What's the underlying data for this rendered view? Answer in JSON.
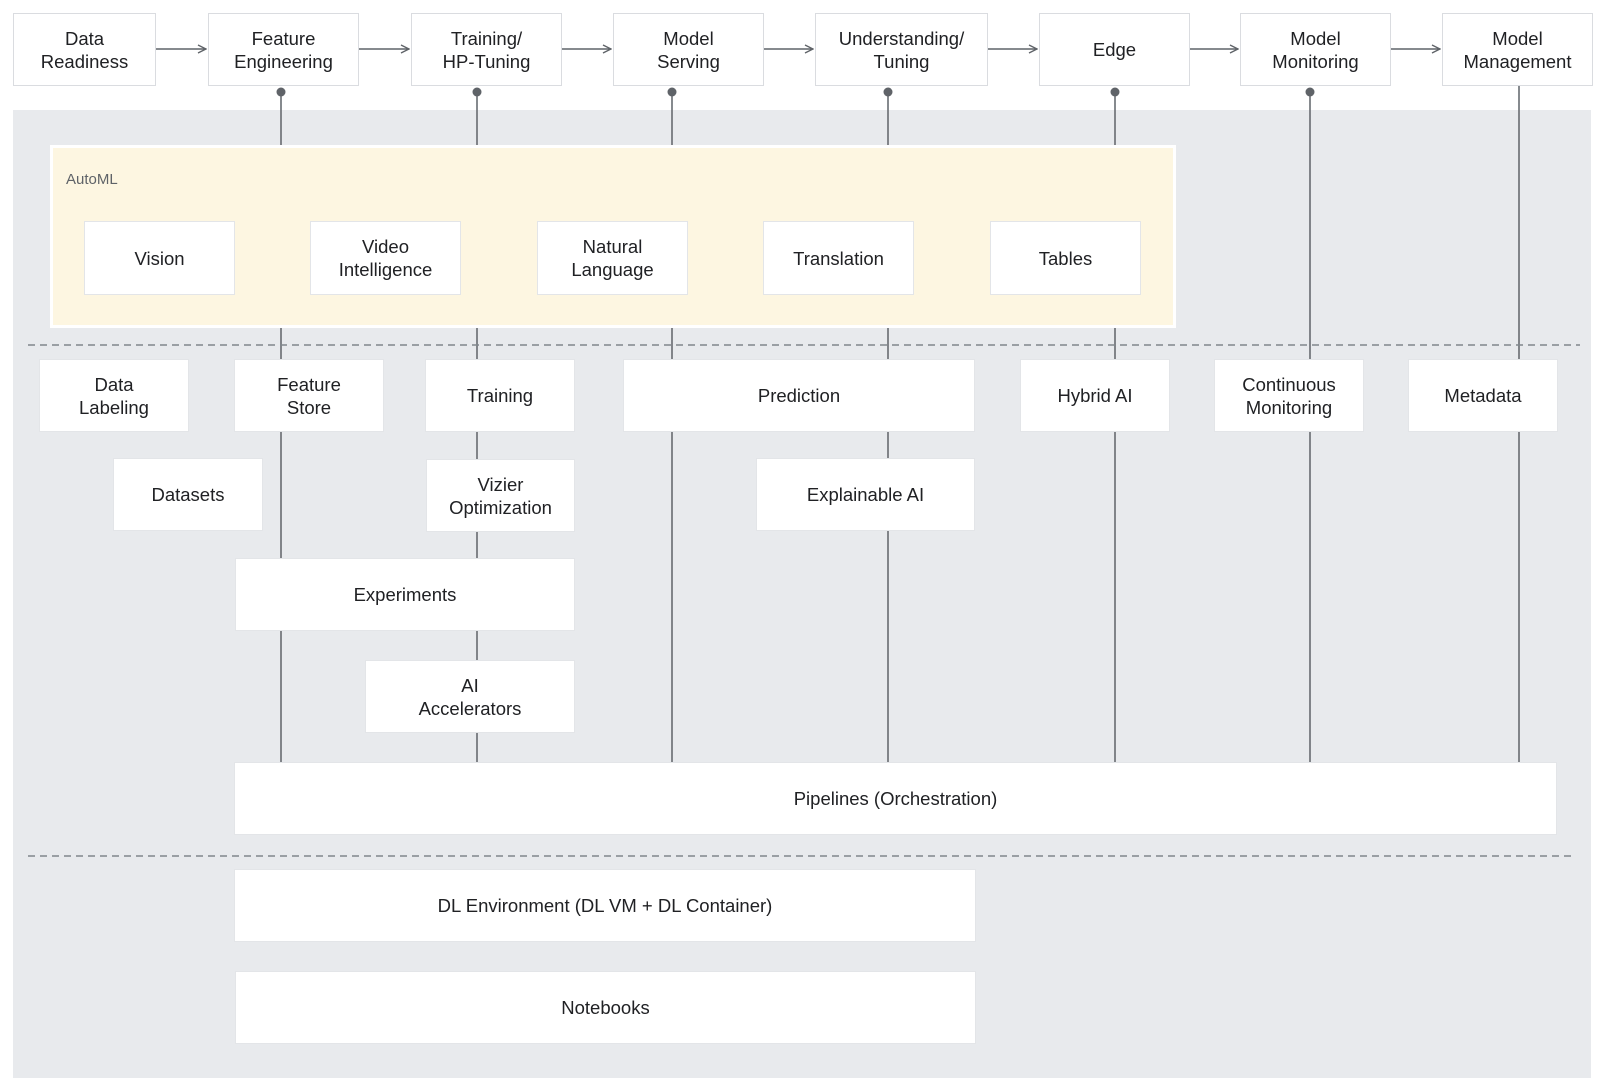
{
  "colors": {
    "panel_bg": "#e8eaed",
    "automl_bg": "#fdf6e1",
    "box_bg": "#ffffff",
    "line": "#5f6368",
    "text": "#202124"
  },
  "pipeline_stages": [
    {
      "id": "data-readiness",
      "label": "Data\nReadiness"
    },
    {
      "id": "feature-engineering",
      "label": "Feature\nEngineering"
    },
    {
      "id": "training-hp-tuning",
      "label": "Training/\nHP-Tuning"
    },
    {
      "id": "model-serving",
      "label": "Model\nServing"
    },
    {
      "id": "understanding-tuning",
      "label": "Understanding/\nTuning"
    },
    {
      "id": "edge",
      "label": "Edge"
    },
    {
      "id": "model-monitoring",
      "label": "Model\nMonitoring"
    },
    {
      "id": "model-management",
      "label": "Model\nManagement"
    }
  ],
  "automl": {
    "title": "AutoML",
    "products": [
      {
        "id": "vision",
        "label": "Vision"
      },
      {
        "id": "video-intelligence",
        "label": "Video\nIntelligence"
      },
      {
        "id": "natural-language",
        "label": "Natural\nLanguage"
      },
      {
        "id": "translation",
        "label": "Translation"
      },
      {
        "id": "tables",
        "label": "Tables"
      }
    ]
  },
  "platform": {
    "row1": [
      {
        "id": "data-labeling",
        "label": "Data\nLabeling"
      },
      {
        "id": "feature-store",
        "label": "Feature\nStore"
      },
      {
        "id": "training",
        "label": "Training"
      },
      {
        "id": "prediction",
        "label": "Prediction"
      },
      {
        "id": "hybrid-ai",
        "label": "Hybrid AI"
      },
      {
        "id": "continuous-monitoring",
        "label": "Continuous\nMonitoring"
      },
      {
        "id": "metadata",
        "label": "Metadata"
      }
    ],
    "row2": [
      {
        "id": "datasets",
        "label": "Datasets"
      },
      {
        "id": "vizier-optimization",
        "label": "Vizier\nOptimization"
      },
      {
        "id": "explainable-ai",
        "label": "Explainable AI"
      }
    ],
    "experiments": {
      "id": "experiments",
      "label": "Experiments"
    },
    "ai_accelerators": {
      "id": "ai-accelerators",
      "label": "AI\nAccelerators"
    },
    "pipelines": {
      "id": "pipelines",
      "label": "Pipelines (Orchestration)"
    }
  },
  "infrastructure": [
    {
      "id": "dl-environment",
      "label": "DL Environment (DL VM + DL Container)"
    },
    {
      "id": "notebooks",
      "label": "Notebooks"
    }
  ]
}
